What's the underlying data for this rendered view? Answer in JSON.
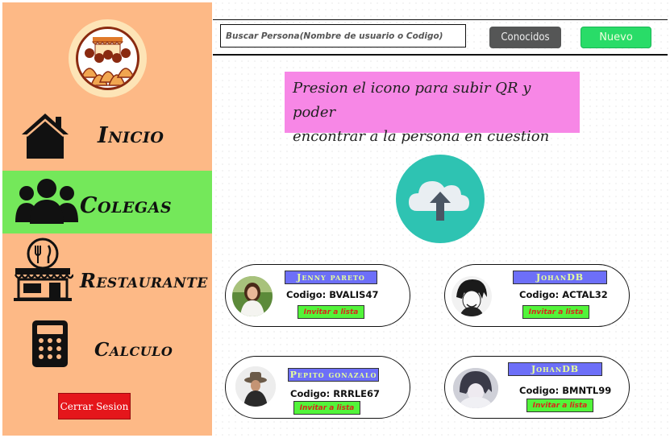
{
  "sidebar": {
    "nav": [
      {
        "label": "Inicio",
        "icon": "house-icon"
      },
      {
        "label": "Colegas",
        "icon": "people-group-icon"
      },
      {
        "label": "Restaurante",
        "icon": "restaurant-icon"
      },
      {
        "label": "Calculo",
        "icon": "calculator-icon"
      }
    ],
    "active_index": 1,
    "logout_label": "Cerrar Sesion"
  },
  "topbar": {
    "search_placeholder": "Buscar Persona(Nombre de usuario o Codigo)",
    "conocidos_label": "Conocidos",
    "nuevo_label": "Nuevo"
  },
  "instruction": {
    "line1": "Presion el icono para subir QR y poder",
    "line2": "encontrar a la persona en cuestion"
  },
  "upload": {
    "icon": "cloud-upload-icon"
  },
  "people": [
    {
      "name": "Jenny pareto",
      "code": "Codigo: BVALIS47",
      "invite": "Invitar a lista"
    },
    {
      "name": "JohanDB",
      "code": "Codigo: ACTAL32",
      "invite": "Invitar a lista"
    },
    {
      "name": "Pepito gonazalo",
      "code": "Codigo: RRRLE67",
      "invite": "Invitar a lista"
    },
    {
      "name": "JohanDB",
      "code": "Codigo: BMNTL99",
      "invite": "Invitar a lista"
    }
  ],
  "colors": {
    "sidebar_bg": "#fdb986",
    "active_nav": "#74e85a",
    "logout": "#e5161b",
    "instruction_bg": "#f787e6",
    "upload_bg": "#2ec3b2",
    "name_tag": "#6d6ff8",
    "invite_bg": "#52f43a",
    "nuevo_bg": "#29dc68",
    "conocidos_bg": "#555656"
  }
}
